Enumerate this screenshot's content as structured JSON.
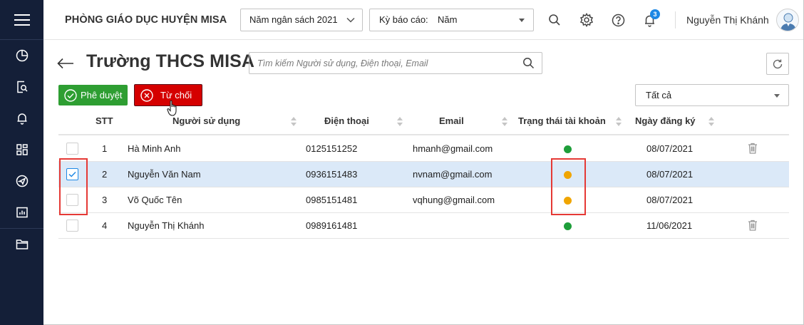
{
  "header": {
    "org_title": "PHÒNG GIÁO DỤC HUYỆN MISA",
    "budget_year": "Năm ngân sách 2021",
    "report_period_label": "Kỳ báo cáo:",
    "report_period_value": "Năm",
    "notification_count": "3",
    "user_name": "Nguyễn Thị Khánh"
  },
  "sidebar": {
    "items": [
      {
        "icon": "pie-chart-icon"
      },
      {
        "icon": "document-search-icon"
      },
      {
        "icon": "bell-icon"
      },
      {
        "icon": "dashboard-grid-icon"
      },
      {
        "icon": "send-icon"
      },
      {
        "icon": "report-chart-icon"
      },
      {
        "icon": "folder-icon"
      }
    ]
  },
  "page": {
    "title": "Trường THCS MISA",
    "search_placeholder": "Tìm kiếm Người sử dụng, Điện thoại, Email",
    "approve_label": "Phê duyệt",
    "reject_label": "Từ chối",
    "filter_value": "Tất cả"
  },
  "table": {
    "columns": [
      "STT",
      "Người sử dụng",
      "Điện thoại",
      "Email",
      "Trạng thái tài khoản",
      "Ngày đăng ký"
    ],
    "rows": [
      {
        "stt": "1",
        "user": "Hà Minh Anh",
        "phone": "0125151252",
        "email": "hmanh@gmail.com",
        "status": "active",
        "date": "08/07/2021",
        "checked": false,
        "deletable": true
      },
      {
        "stt": "2",
        "user": "Nguyễn Văn Nam",
        "phone": "0936151483",
        "email": "nvnam@gmail.com",
        "status": "pending",
        "date": "08/07/2021",
        "checked": true,
        "deletable": false
      },
      {
        "stt": "3",
        "user": "Võ Quốc Tên",
        "phone": "0985151481",
        "email": "vqhung@gmail.com",
        "status": "pending",
        "date": "08/07/2021",
        "checked": false,
        "deletable": false
      },
      {
        "stt": "4",
        "user": "Nguyễn Thị Khánh",
        "phone": "0989161481",
        "email": "",
        "status": "active",
        "date": "11/06/2021",
        "checked": false,
        "deletable": true
      }
    ]
  },
  "colors": {
    "sidebar_bg": "#141f38",
    "approve_green": "#2e9e32",
    "reject_red": "#d50000",
    "status_active": "#1e9e3a",
    "status_pending": "#f0a500",
    "selected_row": "#dbe9f8",
    "highlight_box": "#e53935"
  }
}
